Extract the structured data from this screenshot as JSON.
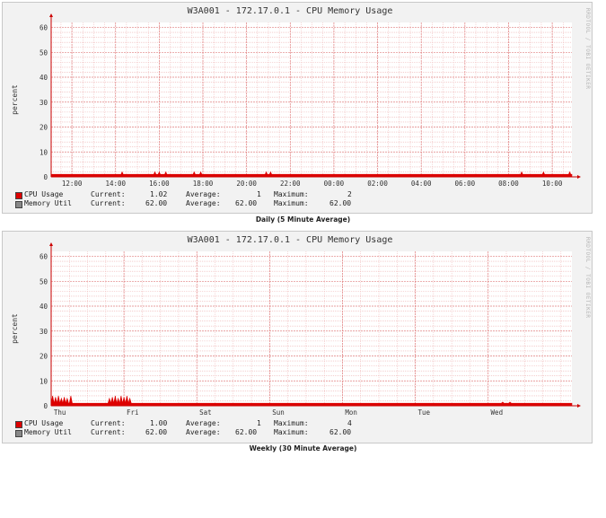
{
  "colors": {
    "cpu": "#dd0000",
    "memory": "#888888",
    "grid": "#eeb0b0",
    "major_grid": "#e08080",
    "axis": "#cc0000",
    "panel_bg": "#f2f2f2"
  },
  "captions": {
    "daily": "Daily (5 Minute Average)",
    "weekly": "Weekly (30 Minute Average)"
  },
  "side_text": "RRDTOOL / TOBI OETIKER",
  "chart_data": [
    {
      "type": "area",
      "title": "W3A001 - 172.17.0.1 - CPU Memory Usage",
      "ylabel": "percent",
      "ylim": [
        0,
        62
      ],
      "yticks": [
        "0",
        "10",
        "20",
        "30",
        "40",
        "50",
        "60"
      ],
      "xticks": [
        "12:00",
        "14:00",
        "16:00",
        "18:00",
        "20:00",
        "22:00",
        "00:00",
        "02:00",
        "04:00",
        "06:00",
        "08:00",
        "10:00"
      ],
      "xrange": [
        11.05,
        34.9
      ],
      "series": [
        {
          "name": "CPU Usage",
          "color": "#dd0000",
          "baseline": 1,
          "spikes": [
            [
              14.3,
              2
            ],
            [
              15.8,
              2
            ],
            [
              16.0,
              2
            ],
            [
              16.3,
              2
            ],
            [
              17.6,
              2
            ],
            [
              17.9,
              2
            ],
            [
              20.9,
              2
            ],
            [
              21.1,
              2
            ],
            [
              32.6,
              2
            ],
            [
              33.6,
              2
            ],
            [
              34.8,
              2
            ]
          ],
          "stats": {
            "current": "1.02",
            "average": "1",
            "maximum": "2"
          }
        },
        {
          "name": "Memory Util",
          "color": "#888888",
          "stats": {
            "current": "62.00",
            "average": "62.00",
            "maximum": "62.00"
          }
        }
      ],
      "legend_labels": {
        "current": "Current:",
        "average": "Average:",
        "maximum": "Maximum:"
      }
    },
    {
      "type": "area",
      "title": "W3A001 - 172.17.0.1 - CPU Memory Usage",
      "ylabel": "percent",
      "ylim": [
        0,
        62
      ],
      "yticks": [
        "0",
        "10",
        "20",
        "30",
        "40",
        "50",
        "60"
      ],
      "xticks": [
        "Thu",
        "Fri",
        "Sat",
        "Sun",
        "Mon",
        "Tue",
        "Wed"
      ],
      "xrange": [
        0,
        7.15
      ],
      "series": [
        {
          "name": "CPU Usage",
          "color": "#dd0000",
          "baseline": 1,
          "spikes": [
            [
              0.02,
              4
            ],
            [
              0.06,
              3.5
            ],
            [
              0.1,
              4
            ],
            [
              0.14,
              3
            ],
            [
              0.18,
              3.5
            ],
            [
              0.22,
              3
            ],
            [
              0.27,
              4
            ],
            [
              0.8,
              3
            ],
            [
              0.84,
              3.5
            ],
            [
              0.88,
              4
            ],
            [
              0.92,
              3
            ],
            [
              0.96,
              4
            ],
            [
              1.0,
              3.5
            ],
            [
              1.04,
              4
            ],
            [
              1.08,
              3
            ],
            [
              6.2,
              1.5
            ],
            [
              6.3,
              1.5
            ]
          ],
          "stats": {
            "current": "1.00",
            "average": "1",
            "maximum": "4"
          }
        },
        {
          "name": "Memory Util",
          "color": "#888888",
          "stats": {
            "current": "62.00",
            "average": "62.00",
            "maximum": "62.00"
          }
        }
      ],
      "legend_labels": {
        "current": "Current:",
        "average": "Average:",
        "maximum": "Maximum:"
      }
    }
  ]
}
